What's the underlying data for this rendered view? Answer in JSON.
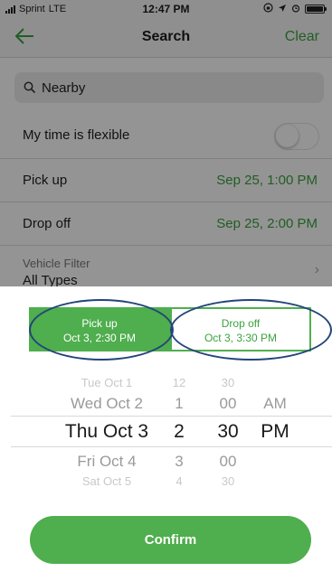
{
  "status": {
    "carrier": "Sprint",
    "network": "LTE",
    "time": "12:47 PM"
  },
  "nav": {
    "title": "Search",
    "clear_label": "Clear"
  },
  "search": {
    "text": "Nearby"
  },
  "flexible": {
    "label": "My time is flexible",
    "enabled": false
  },
  "pickup_row": {
    "label": "Pick up",
    "value": "Sep 25, 1:00 PM"
  },
  "dropoff_row": {
    "label": "Drop off",
    "value": "Sep 25, 2:00 PM"
  },
  "vehicle_filter": {
    "label": "Vehicle Filter",
    "value": "All Types"
  },
  "tabs": {
    "pickup": {
      "label": "Pick up",
      "value": "Oct 3, 2:30 PM",
      "selected": true
    },
    "dropoff": {
      "label": "Drop off",
      "value": "Oct 3, 3:30 PM",
      "selected": false
    }
  },
  "picker": {
    "dates": [
      "Tue Oct 1",
      "Wed Oct 2",
      "Thu Oct 3",
      "Fri Oct 4",
      "Sat Oct 5"
    ],
    "hours": [
      "12",
      "1",
      "2",
      "3",
      "4"
    ],
    "minutes": [
      "30",
      "00",
      "30",
      "00",
      "30"
    ],
    "ampm": [
      "AM",
      "PM"
    ]
  },
  "confirm_label": "Confirm",
  "colors": {
    "accent": "#4fae4e",
    "annotation_ring": "#23457a"
  }
}
